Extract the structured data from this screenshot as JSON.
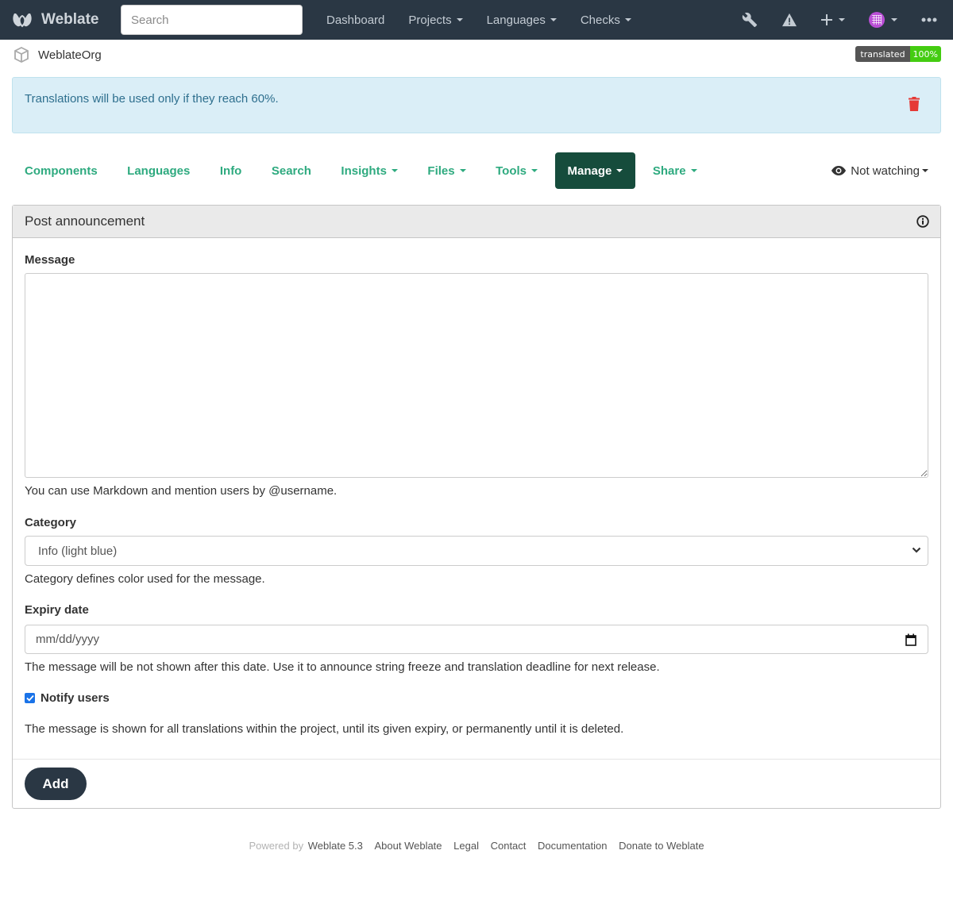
{
  "navbar": {
    "brand": "Weblate",
    "search_placeholder": "Search",
    "links": [
      {
        "label": "Dashboard",
        "dropdown": false
      },
      {
        "label": "Projects",
        "dropdown": true
      },
      {
        "label": "Languages",
        "dropdown": true
      },
      {
        "label": "Checks",
        "dropdown": true
      }
    ],
    "icons": [
      "wrench-icon",
      "warning-icon",
      "plus-icon",
      "avatar",
      "more-icon"
    ]
  },
  "breadcrumb": {
    "project": "WeblateOrg"
  },
  "badge": {
    "label": "translated",
    "value": "100%"
  },
  "alert": {
    "text": "Translations will be used only if they reach 60%."
  },
  "tabs": [
    {
      "label": "Components",
      "dropdown": false,
      "active": false
    },
    {
      "label": "Languages",
      "dropdown": false,
      "active": false
    },
    {
      "label": "Info",
      "dropdown": false,
      "active": false
    },
    {
      "label": "Search",
      "dropdown": false,
      "active": false
    },
    {
      "label": "Insights",
      "dropdown": true,
      "active": false
    },
    {
      "label": "Files",
      "dropdown": true,
      "active": false
    },
    {
      "label": "Tools",
      "dropdown": true,
      "active": false
    },
    {
      "label": "Manage",
      "dropdown": true,
      "active": true
    },
    {
      "label": "Share",
      "dropdown": true,
      "active": false
    }
  ],
  "watch": {
    "label": "Not watching"
  },
  "panel": {
    "title": "Post announcement",
    "message": {
      "label": "Message",
      "value": "",
      "help": "You can use Markdown and mention users by @username."
    },
    "category": {
      "label": "Category",
      "selected": "Info (light blue)",
      "help": "Category defines color used for the message."
    },
    "expiry": {
      "label": "Expiry date",
      "placeholder": "mm/dd/yyyy",
      "help": "The message will be not shown after this date. Use it to announce string freeze and translation deadline for next release."
    },
    "notify": {
      "label": "Notify users",
      "checked": true
    },
    "note": "The message is shown for all translations within the project, until its given expiry, or permanently until it is deleted.",
    "submit_label": "Add"
  },
  "footer": {
    "powered_by": "Powered by",
    "links": [
      "Weblate 5.3",
      "About Weblate",
      "Legal",
      "Contact",
      "Documentation",
      "Donate to Weblate"
    ]
  }
}
